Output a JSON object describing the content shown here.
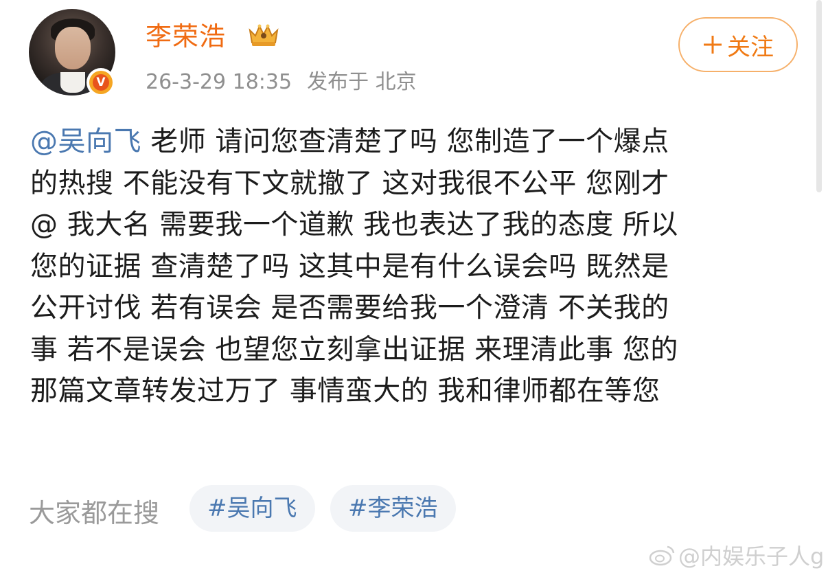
{
  "post": {
    "author": {
      "name": "李荣浩",
      "verified_badge": "V"
    },
    "meta": {
      "time": "26-3-29 18:35",
      "location": "发布于 北京"
    },
    "follow_label": "关注",
    "follow_icon": "plus-icon",
    "mention": "@吴向飞",
    "content_lines": [
      " 老师 请问您查清楚了吗 您制造了一个爆点",
      "的热搜 不能没有下文就撤了 这对我很不公平 您刚才",
      "@ 我大名 需要我一个道歉  我也表达了我的态度 所以",
      "您的证据 查清楚了吗 这其中是有什么误会吗 既然是",
      "公开讨伐 若有误会 是否需要给我一个澄清 不关我的",
      "事 若不是误会 也望您立刻拿出证据 来理清此事 您的",
      "那篇文章转发过万了 事情蛮大的 我和律师都在等您"
    ]
  },
  "search": {
    "label": "大家都在搜",
    "tags": [
      "#吴向飞",
      "#李荣浩"
    ]
  },
  "watermark": "@内娱乐子人g",
  "colors": {
    "username": "#f06b12",
    "link": "#4a78b0",
    "follow_border": "#f6b06a",
    "meta": "#8f8f8f"
  }
}
